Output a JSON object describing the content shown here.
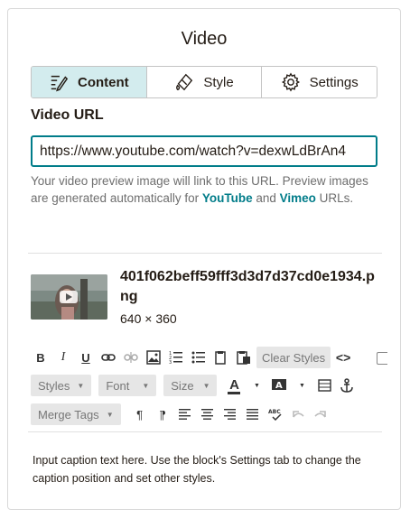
{
  "panel": {
    "title": "Video"
  },
  "tabs": [
    {
      "label": "Content",
      "icon": "edit-icon",
      "active": true
    },
    {
      "label": "Style",
      "icon": "paint-bucket-icon",
      "active": false
    },
    {
      "label": "Settings",
      "icon": "gear-icon",
      "active": false
    }
  ],
  "video_url": {
    "label": "Video URL",
    "value": "https://www.youtube.com/watch?v=dexwLdBrAn4",
    "help_prefix": "Your video preview image will link to this URL. Preview images are generated automatically for ",
    "help_link1": "YouTube",
    "help_mid": " and ",
    "help_link2": "Vimeo",
    "help_suffix": " URLs."
  },
  "image": {
    "filename": "401f062beff59fff3d3d7d37cd0e1934.png",
    "dimensions": "640 × 360"
  },
  "toolbar": {
    "bold": "B",
    "italic": "I",
    "underline": "U",
    "clear_styles": "Clear Styles",
    "styles": "Styles",
    "font": "Font",
    "size": "Size",
    "merge_tags": "Merge Tags"
  },
  "caption": {
    "text": "Input caption text here. Use the block's Settings tab to change the caption position and set other styles."
  },
  "colors": {
    "accent": "#007c89",
    "active_tab_bg": "#d3ecee"
  }
}
